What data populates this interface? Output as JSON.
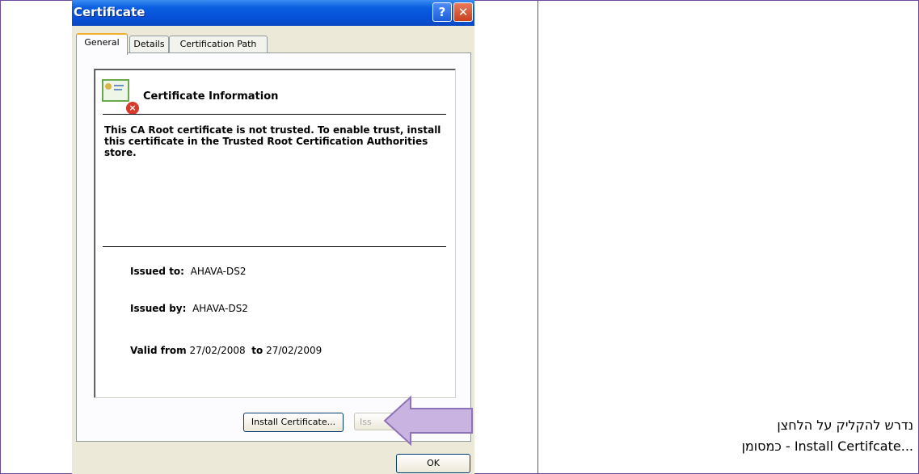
{
  "dialog": {
    "title": "Certificate",
    "help_glyph": "?",
    "close_glyph": "✕",
    "tabs": [
      {
        "label": "General"
      },
      {
        "label": "Details"
      },
      {
        "label": "Certification Path"
      }
    ],
    "info_title": "Certificate Information",
    "warning": "This CA Root certificate is not trusted. To enable trust, install this certificate in the Trusted Root Certification Authorities store.",
    "issued_to_label": "Issued to:",
    "issued_to_value": "AHAVA-DS2",
    "issued_by_label": "Issued by:",
    "issued_by_value": "AHAVA-DS2",
    "valid_from_label": "Valid from",
    "valid_from_value": "27/02/2008",
    "valid_to_label": "to",
    "valid_to_value": "27/02/2009",
    "install_button": "Install Certificate...",
    "issuer_button": "Iss",
    "ok_button": "OK"
  },
  "annotation": {
    "arrow_color": "#c9b3e0",
    "arrow_border": "#8e72b8"
  },
  "caption": {
    "line1": "נדרש להקליק על הלחצן",
    "line2": "...Install Certifcate - כמסומן"
  }
}
